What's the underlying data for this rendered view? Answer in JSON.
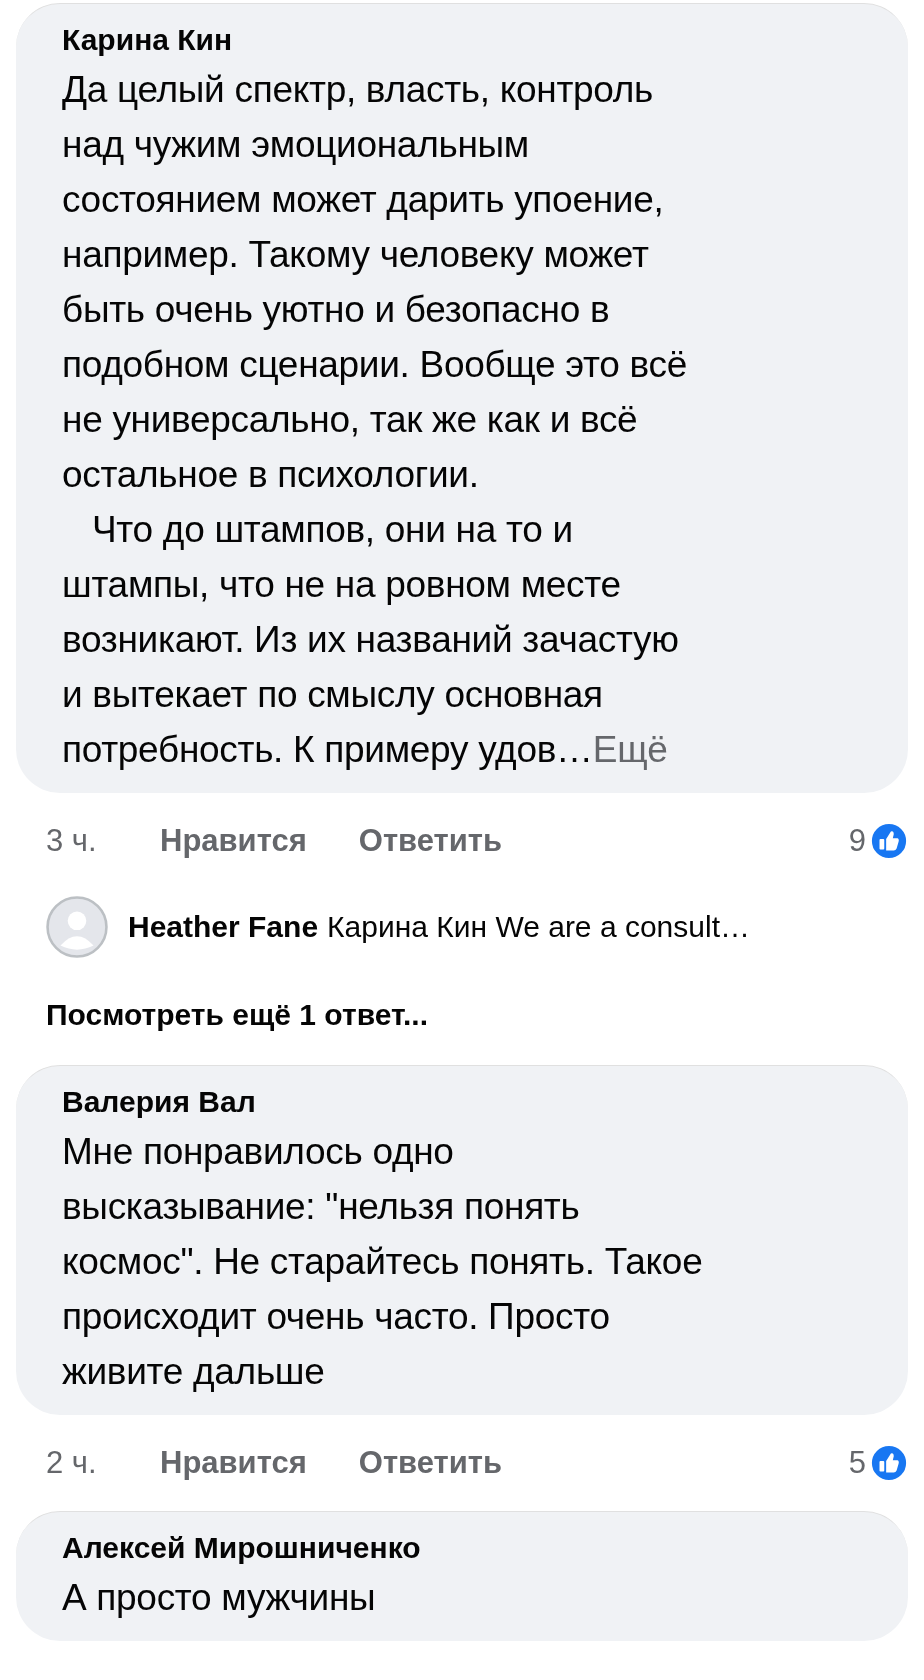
{
  "comments": [
    {
      "author": "Карина Кин",
      "paragraphs": [
        [
          "Да целый спектр, власть, контроль",
          "над чужим эмоциональным",
          "состоянием может дарить упоение,",
          "например. Такому человеку может",
          "быть очень уютно и безопасно в",
          "подобном сценарии. Вообще это всё",
          "не универсально, так же как и всё",
          "остальное в психологии."
        ],
        [
          "Что до штампов, они на то и",
          "штампы, что не на ровном месте",
          "возникают. Из их названий зачастую",
          "и вытекает по смыслу основная",
          "потребность. К примеру удов…"
        ]
      ],
      "more": "Ещё",
      "time": "3 ч.",
      "like": "Нравится",
      "reply": "Ответить",
      "likes": "9",
      "replies": [
        {
          "author": "Heather Fane",
          "text": "Карина Кин We are a consult…"
        }
      ],
      "view_more": "Посмотреть ещё 1 ответ..."
    },
    {
      "author": "Валерия Вал",
      "paragraphs": [
        [
          "Мне понравилось одно",
          "высказывание: \"нельзя понять",
          "космос\". Не старайтесь понять. Такое",
          "происходит очень часто. Просто",
          "живите дальше"
        ]
      ],
      "time": "2 ч.",
      "like": "Нравится",
      "reply": "Ответить",
      "likes": "5"
    },
    {
      "author": "Алексей Мирошниченко",
      "paragraphs": [
        [
          "А просто мужчины"
        ]
      ]
    }
  ]
}
